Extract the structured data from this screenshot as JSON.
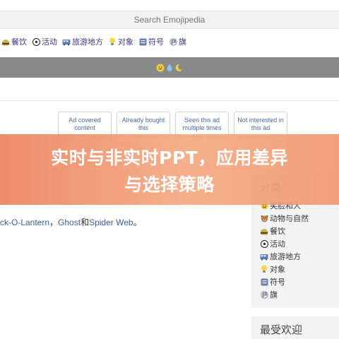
{
  "search": {
    "placeholder": "Search Emojipedia"
  },
  "category_nav": [
    {
      "icon": "hamburger-food-icon",
      "label": "餐饮"
    },
    {
      "icon": "soccer-ball-icon",
      "label": "活动"
    },
    {
      "icon": "railway-car-icon",
      "label": "旅游地方"
    },
    {
      "icon": "light-bulb-icon",
      "label": "对象"
    },
    {
      "icon": "symbols-icon",
      "label": "符号"
    },
    {
      "icon": "flag-icon",
      "label": "旗"
    }
  ],
  "header_emojis": [
    "grinning-face-icon",
    "droplet-icon",
    "crescent-moon-icon"
  ],
  "ad_feedback": [
    "Ad covered content",
    "Already bought this",
    "Seen this ad multiple times",
    "Not interested in this ad"
  ],
  "overlay": {
    "line1": "实时与非实时PPT，应用差异",
    "line2": "与选择策略"
  },
  "related": {
    "prefix": "ck-O-Lantern",
    "separator1": "，",
    "link2": "Ghost",
    "joiner": "和",
    "link3": "Spider Web",
    "suffix": "。"
  },
  "sidebar": {
    "title": "分类",
    "items": [
      {
        "icon": "smiley-icon",
        "label": "笑脸和人"
      },
      {
        "icon": "bear-face-icon",
        "label": "动物与自然"
      },
      {
        "icon": "hamburger-food-icon",
        "label": "餐饮"
      },
      {
        "icon": "soccer-ball-icon",
        "label": "活动"
      },
      {
        "icon": "railway-car-icon",
        "label": "旅游地方"
      },
      {
        "icon": "light-bulb-icon",
        "label": "对象"
      },
      {
        "icon": "symbols-icon",
        "label": "符号"
      },
      {
        "icon": "flag-icon",
        "label": "旗"
      }
    ],
    "recent_title": "最受欢迎"
  }
}
